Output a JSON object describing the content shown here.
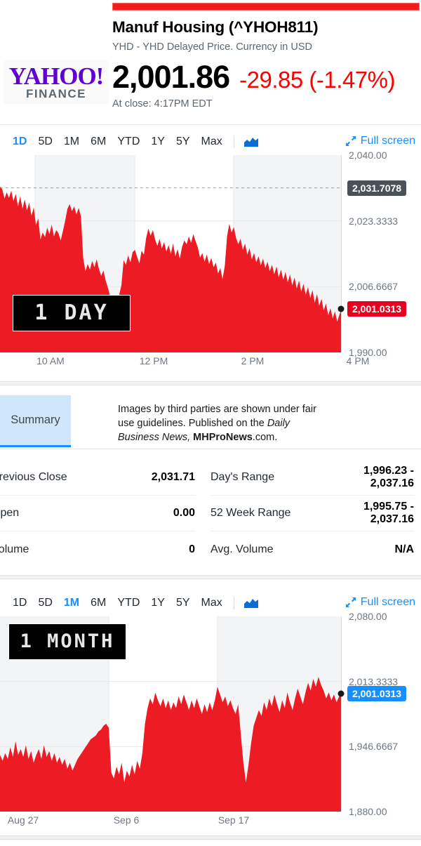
{
  "header": {
    "brand_yahoo": "YAHOO!",
    "brand_finance": "FINANCE",
    "title": "Manuf Housing (^YHOH811)",
    "subtitle": "YHD - YHD Delayed Price. Currency in USD",
    "price": "2,001.86",
    "change": "-29.85 (-1.47%)",
    "change_color": "#ff0000",
    "market_state": "At close: 4:17PM EDT"
  },
  "chart1": {
    "ranges": [
      {
        "label": "1D",
        "active": true
      },
      {
        "label": "5D",
        "active": false
      },
      {
        "label": "1M",
        "active": false
      },
      {
        "label": "6M",
        "active": false
      },
      {
        "label": "YTD",
        "active": false
      },
      {
        "label": "1Y",
        "active": false
      },
      {
        "label": "5Y",
        "active": false
      },
      {
        "label": "Max",
        "active": false
      }
    ],
    "chart_type_icon": "area-chart-icon",
    "fullscreen_label": "Full screen",
    "fullscreen_icon": "expand-arrows-icon",
    "stamp": "1 DAY",
    "previous_close_flag": "2,031.7078",
    "last_price_flag": "2,001.0313"
  },
  "chart2": {
    "ranges": [
      {
        "label": "1D",
        "active": false
      },
      {
        "label": "5D",
        "active": false
      },
      {
        "label": "1M",
        "active": true
      },
      {
        "label": "6M",
        "active": false
      },
      {
        "label": "YTD",
        "active": false
      },
      {
        "label": "1Y",
        "active": false
      },
      {
        "label": "5Y",
        "active": false
      },
      {
        "label": "Max",
        "active": false
      }
    ],
    "chart_type_icon": "area-chart-icon",
    "fullscreen_label": "Full screen",
    "fullscreen_icon": "expand-arrows-icon",
    "stamp": "1 MONTH",
    "last_price_flag": "2,001.0313"
  },
  "summary": {
    "tab_label": "Summary",
    "note_line1": "Images by third parties are shown under",
    "note_line2_a": "fair use guidelines.  Published on the ",
    "note_line2_em": "Daily",
    "note_line3_em": "Business News,",
    "note_line3_strong": " MHProNews",
    "note_line3_tail": ".com."
  },
  "stats": {
    "left": [
      {
        "label": "Previous Close",
        "value": "2,031.71"
      },
      {
        "label": "Open",
        "value": "0.00"
      },
      {
        "label": "Volume",
        "value": "0"
      }
    ],
    "right": [
      {
        "label": "Day's Range",
        "value": "1,996.23 -\n2,037.16"
      },
      {
        "label": "52 Week Range",
        "value": "1,995.75 -\n2,037.16"
      },
      {
        "label": "Avg. Volume",
        "value": "N/A"
      }
    ]
  },
  "chart_data": [
    {
      "type": "area",
      "title": "Manuf Housing (^YHOH811) - 1 Day",
      "range": "1D",
      "xlabel": "",
      "ylabel": "",
      "ylim": [
        1990.0,
        2040.0
      ],
      "yticks": [
        2040.0,
        2023.3333,
        2006.6667,
        1990.0
      ],
      "ytick_labels": [
        "2,040.00",
        "2,023.3333",
        "2,006.6667",
        "1,990.00"
      ],
      "xticks": [
        "10 AM",
        "12 PM",
        "2 PM",
        "4 PM"
      ],
      "grid": true,
      "legend": "none",
      "fill_color": "#ed1c24",
      "previous_close_line": 2031.7078,
      "last_price": 2001.0313,
      "annotations": [
        {
          "text": "2,031.7078",
          "value": 2031.7078,
          "color": "#4a5259"
        },
        {
          "text": "2,001.0313",
          "value": 2001.0313,
          "color": "#e8001f"
        }
      ],
      "values": [
        2032.0,
        2031.4,
        2029.0,
        2030.6,
        2029.2,
        2031.0,
        2028.4,
        2030.2,
        2027.0,
        2029.6,
        2026.4,
        2028.8,
        2026.0,
        2028.0,
        2024.6,
        2026.8,
        2022.2,
        2024.0,
        2018.6,
        2020.4,
        2019.2,
        2021.6,
        2020.0,
        2022.4,
        2019.4,
        2021.0,
        2020.2,
        2018.4,
        2020.8,
        2023.4,
        2026.4,
        2027.6,
        2025.8,
        2027.0,
        2025.0,
        2026.6,
        2024.4,
        2014.0,
        2010.6,
        2012.4,
        2011.0,
        2013.2,
        2011.6,
        2013.6,
        2011.2,
        2009.4,
        2010.8,
        2008.2,
        2006.4,
        2004.2,
        2002.6,
        2003.8,
        2002.0,
        2004.6,
        2007.0,
        2013.4,
        2012.2,
        2014.6,
        2012.8,
        2015.4,
        2016.0,
        2014.2,
        2012.6,
        2015.8,
        2014.8,
        2019.0,
        2021.4,
        2019.6,
        2021.0,
        2018.6,
        2017.0,
        2018.8,
        2016.4,
        2018.0,
        2015.6,
        2017.2,
        2015.0,
        2017.6,
        2014.4,
        2016.2,
        2013.8,
        2016.8,
        2018.4,
        2017.4,
        2019.4,
        2017.8,
        2020.0,
        2018.2,
        2016.6,
        2014.0,
        2015.2,
        2013.0,
        2014.8,
        2012.4,
        2014.0,
        2011.6,
        2012.8,
        2010.0,
        2011.4,
        2008.6,
        2012.0,
        2019.4,
        2022.6,
        2020.4,
        2021.8,
        2019.0,
        2017.4,
        2018.8,
        2016.0,
        2017.6,
        2014.8,
        2016.4,
        2013.6,
        2015.2,
        2012.8,
        2014.4,
        2012.0,
        2013.8,
        2011.4,
        2013.0,
        2010.6,
        2012.2,
        2009.8,
        2011.8,
        2009.0,
        2011.0,
        2008.4,
        2010.4,
        2007.8,
        2009.8,
        2007.0,
        2009.0,
        2006.2,
        2008.2,
        2005.4,
        2007.4,
        2004.6,
        2006.6,
        2003.8,
        2005.8,
        2002.6,
        2004.8,
        2001.8,
        2003.6,
        2000.6,
        2002.4,
        1999.4,
        2001.2,
        1998.6,
        2000.4,
        1997.8,
        1999.6,
        2001.0313
      ]
    },
    {
      "type": "area",
      "title": "Manuf Housing (^YHOH811) - 1 Month",
      "range": "1M",
      "xlabel": "",
      "ylabel": "",
      "ylim": [
        1880.0,
        2080.0
      ],
      "yticks": [
        2080.0,
        2013.3333,
        1946.6667,
        1880.0
      ],
      "ytick_labels": [
        "2,080.00",
        "2,013.3333",
        "1,946.6667",
        "1,880.00"
      ],
      "xticks": [
        "Aug 27",
        "Sep 6",
        "Sep 17"
      ],
      "grid": true,
      "legend": "none",
      "fill_color": "#ed1c24",
      "last_price": 2001.0313,
      "annotations": [
        {
          "text": "2,001.0313",
          "value": 2001.0313,
          "color": "#188fff"
        }
      ],
      "values": [
        1938.0,
        1932.0,
        1940.0,
        1934.0,
        1946.0,
        1936.0,
        1952.0,
        1938.0,
        1944.0,
        1936.0,
        1948.0,
        1934.0,
        1942.0,
        1930.0,
        1938.0,
        1944.0,
        1934.0,
        1948.0,
        1936.0,
        1942.0,
        1932.0,
        1940.0,
        1930.0,
        1936.0,
        1928.0,
        1934.0,
        1924.0,
        1930.0,
        1922.0,
        1928.0,
        1934.0,
        1938.0,
        1942.0,
        1946.0,
        1950.0,
        1954.0,
        1956.0,
        1958.0,
        1962.0,
        1964.0,
        1968.0,
        1970.0,
        1966.0,
        1920.0,
        1914.0,
        1926.0,
        1918.0,
        1930.0,
        1910.0,
        1922.0,
        1916.0,
        1928.0,
        1918.0,
        1932.0,
        1924.0,
        1940.0,
        1970.0,
        1986.0,
        1996.0,
        1990.0,
        2002.0,
        1994.0,
        1988.0,
        1996.0,
        1986.0,
        1994.0,
        1984.0,
        1992.0,
        1986.0,
        1998.0,
        1990.0,
        2000.0,
        1992.0,
        1984.0,
        1994.0,
        1986.0,
        1996.0,
        1988.0,
        1980.0,
        1990.0,
        1982.0,
        1992.0,
        1984.0,
        1994.0,
        2008.0,
        2000.0,
        1992.0,
        1998.0,
        1988.0,
        1994.0,
        1986.0,
        1980.0,
        1990.0,
        1960.0,
        1930.0,
        1910.0,
        1928.0,
        1950.0,
        1968.0,
        1976.0,
        1984.0,
        1978.0,
        1992.0,
        1984.0,
        1996.0,
        1988.0,
        2000.0,
        1990.0,
        1982.0,
        1994.0,
        1986.0,
        2002.0,
        1992.0,
        1984.0,
        1996.0,
        2006.0,
        1998.0,
        1990.0,
        2002.0,
        2012.0,
        2004.0,
        2016.0,
        2008.0,
        2018.0,
        2010.0,
        2004.0,
        1996.0,
        2002.0,
        1994.0,
        2000.0,
        1992.0,
        1998.0,
        2001.0313
      ]
    }
  ]
}
